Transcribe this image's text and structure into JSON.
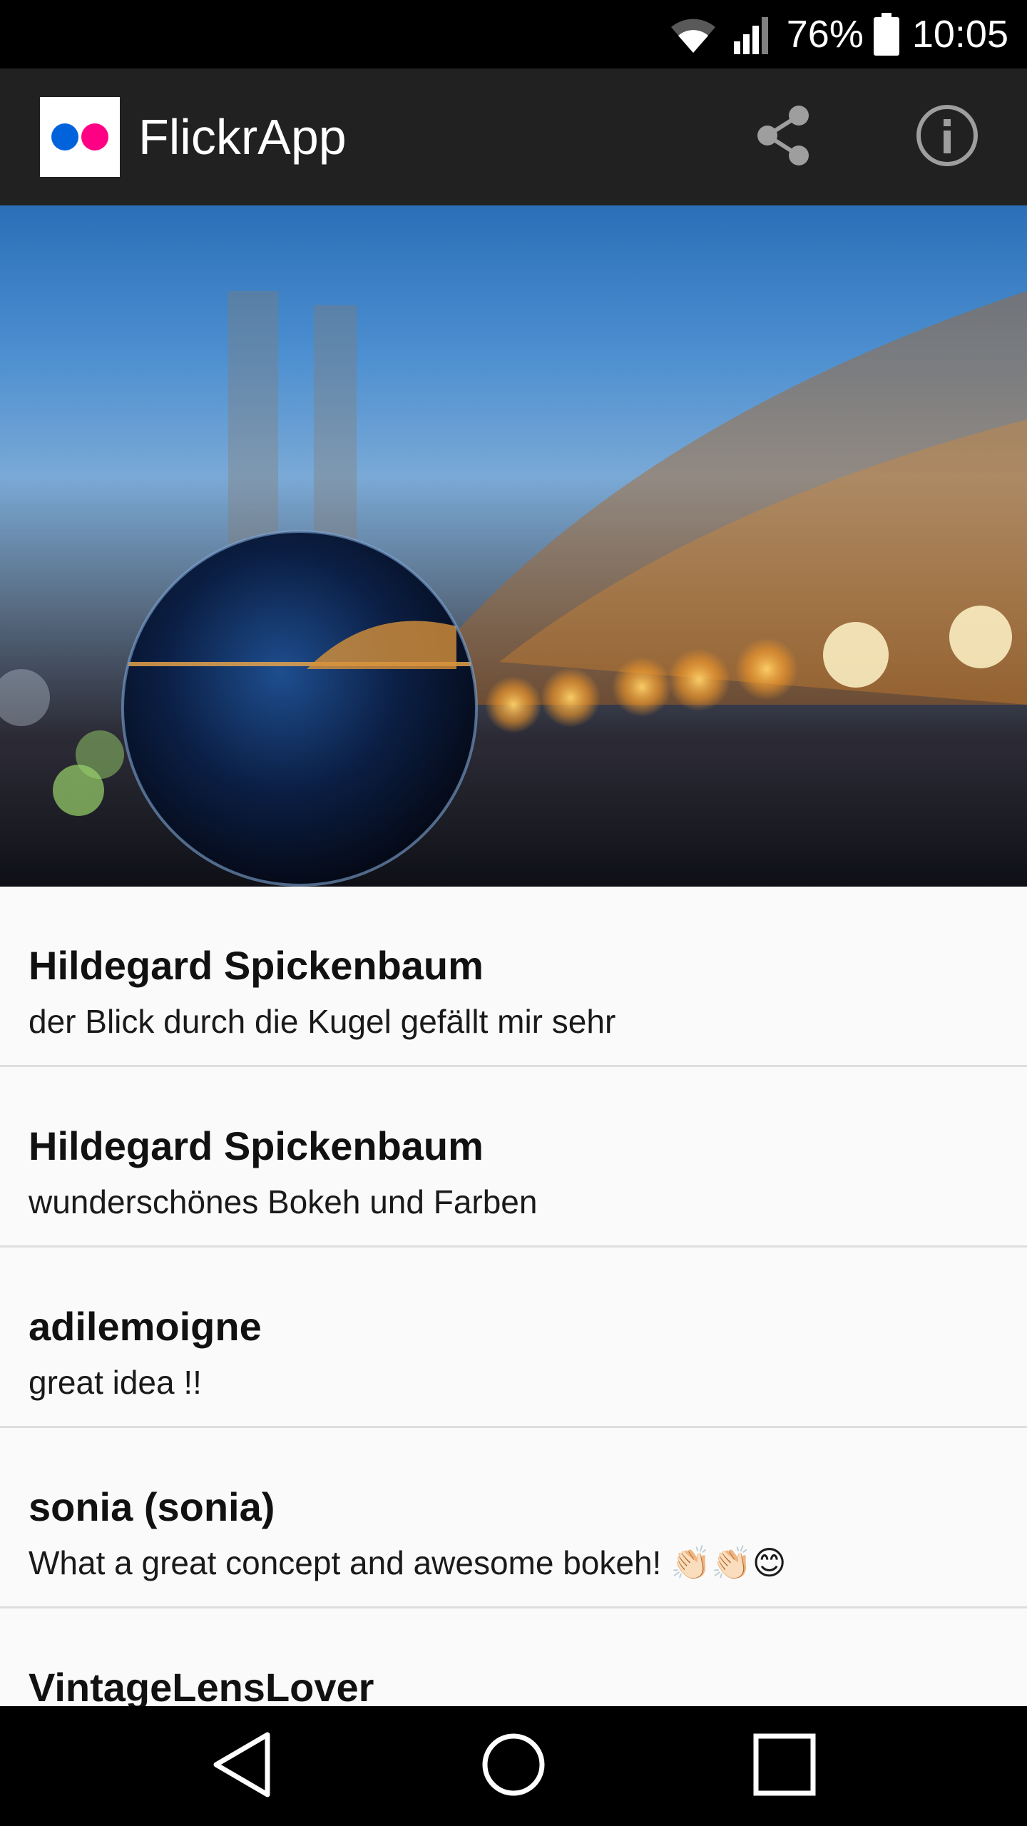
{
  "status_bar": {
    "battery_percent": "76%",
    "time": "10:05",
    "icons": [
      "wifi-icon",
      "signal-icon",
      "battery-icon"
    ]
  },
  "app_bar": {
    "title": "FlickrApp",
    "logo_icon": "flickr-logo-icon",
    "logo_colors": [
      "#0063dc",
      "#ff0084"
    ],
    "actions": [
      "share-icon",
      "info-icon"
    ]
  },
  "photo": {
    "icon": "photo-crystal-ball-bridge"
  },
  "comments": [
    {
      "author": "Hildegard Spickenbaum",
      "text": "der Blick durch die Kugel gefällt mir sehr"
    },
    {
      "author": "Hildegard Spickenbaum",
      "text": "wunderschönes Bokeh und Farben"
    },
    {
      "author": "adilemoigne",
      "text": "great idea !!"
    },
    {
      "author": "sonia (sonia)",
      "text": "What a great concept and awesome bokeh! 👏🏻👏🏻😊"
    },
    {
      "author": "VintageLensLover",
      "text": ""
    }
  ],
  "nav_bar": {
    "buttons": [
      "back-icon",
      "home-icon",
      "recents-icon"
    ]
  },
  "colors": {
    "status_bar": "#000000",
    "app_bar": "#212121",
    "list_background": "#fafafa",
    "divider": "#dedede"
  }
}
